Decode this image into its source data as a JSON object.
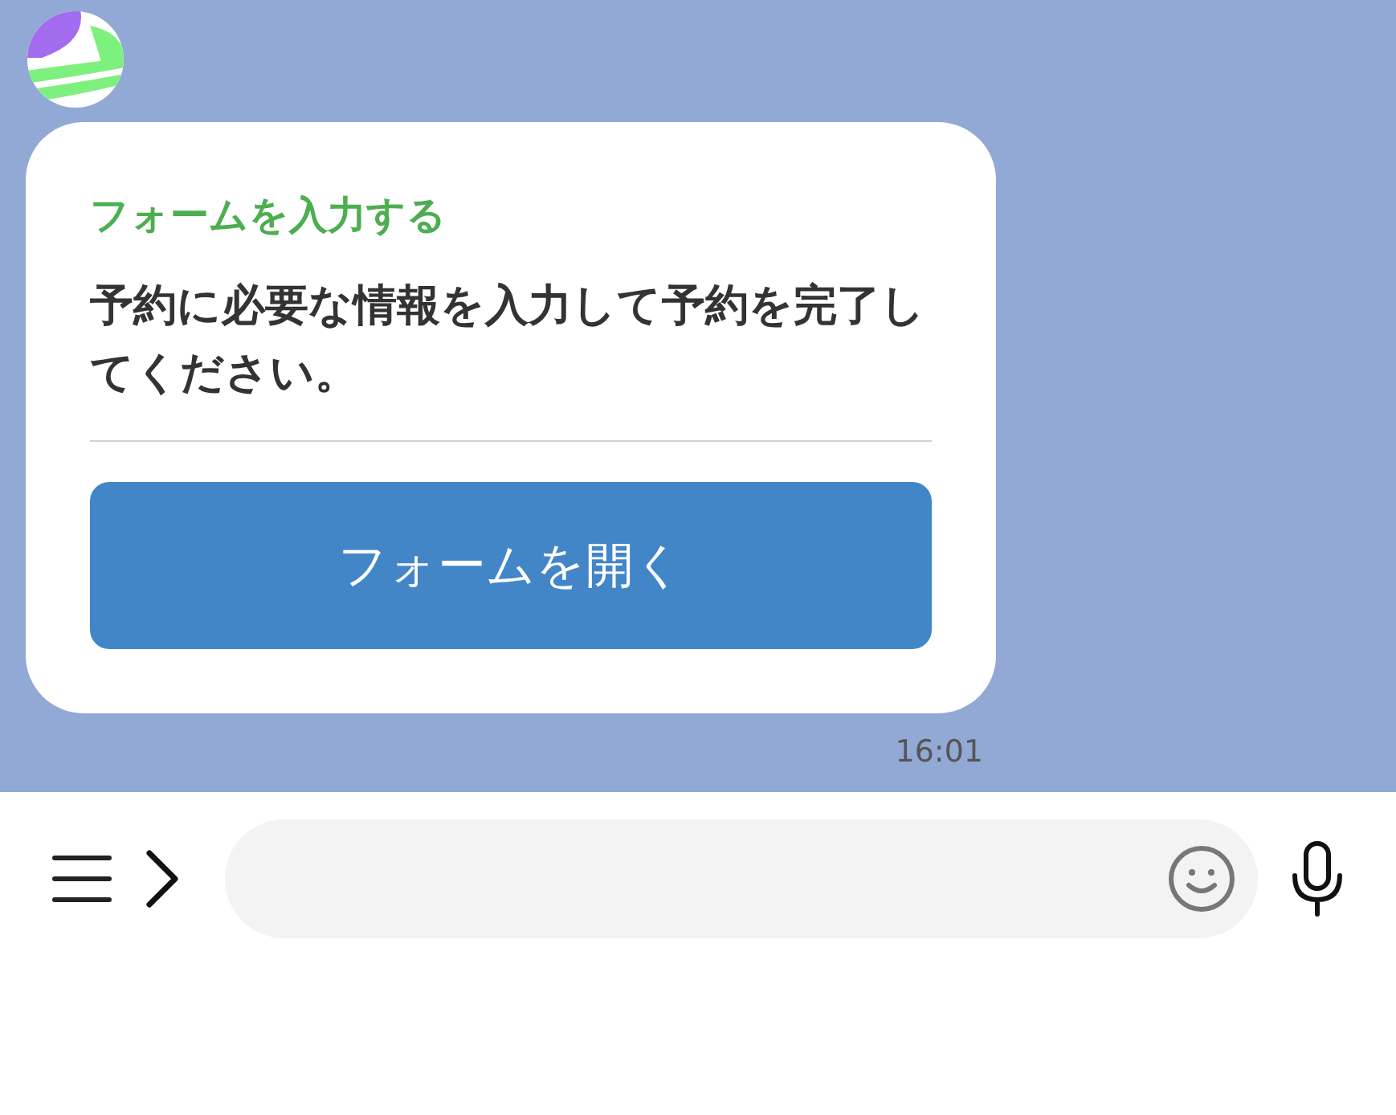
{
  "message": {
    "title": "フォームを入力する",
    "body": "予約に必要な情報を入力して予約を完了してください。",
    "button": "フォームを開く",
    "time": "16:01"
  }
}
